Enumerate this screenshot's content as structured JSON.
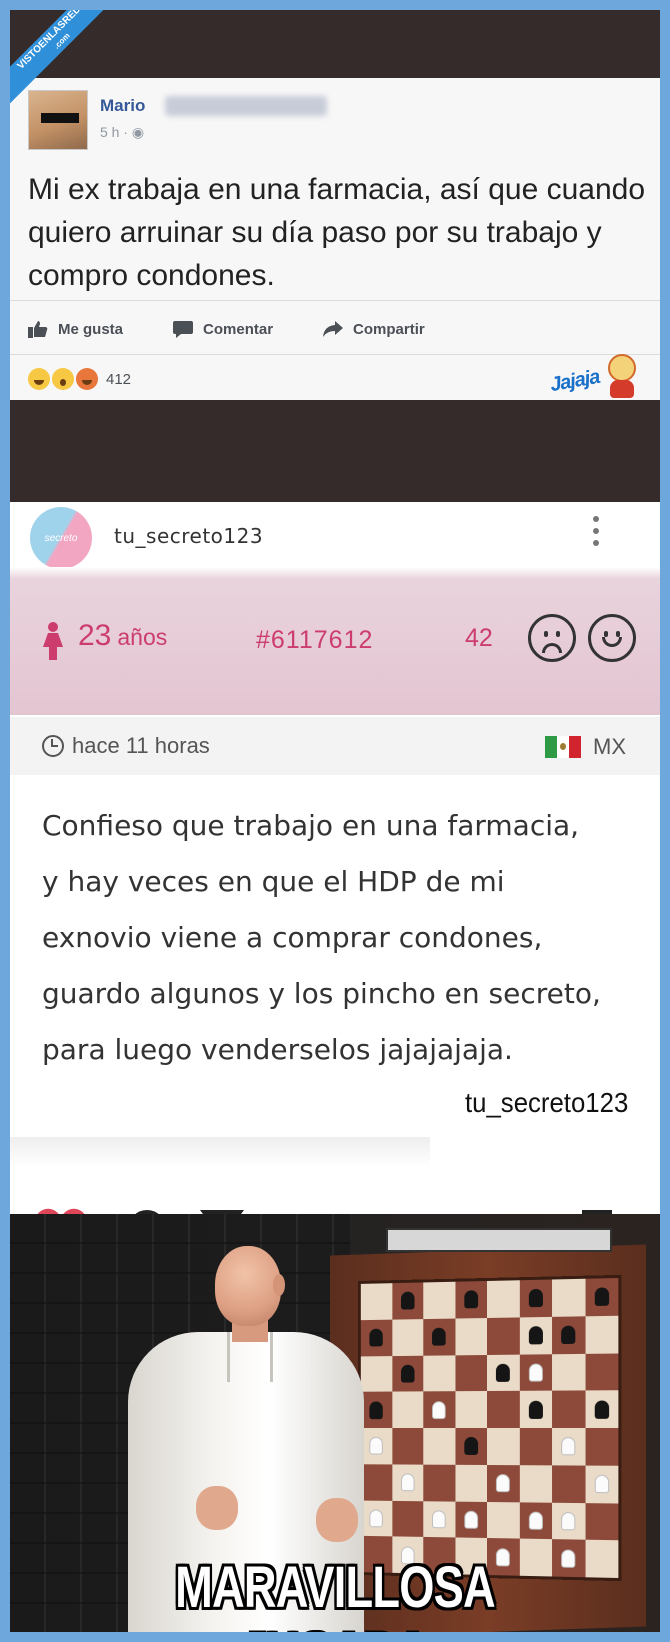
{
  "watermark": {
    "brand": "VISTOENLASREDES",
    "suffix": ".com"
  },
  "facebook": {
    "author": "Mario",
    "time": "5 h · ",
    "post_text": "Mi ex trabaja en una farmacia, así que cuando quiero arruinar su día paso por su trabajo y compro condones.",
    "actions": {
      "like": "Me gusta",
      "comment": "Comentar",
      "share": "Compartir"
    },
    "reactions": [
      "haha",
      "wow",
      "angry"
    ],
    "reaction_count": "412",
    "sticker_text": "Jajaja"
  },
  "confession": {
    "username": "tu_secreto123",
    "avatar_text": "secreto",
    "age": "23",
    "age_unit": "años",
    "post_id": "#6117612",
    "votes": "42",
    "posted": "hace 11 horas",
    "country": "MX",
    "text": "Confieso que trabajo en una farmacia, y hay veces en que el HDP de mi exnovio viene a comprar condones, guardo algunos y los pincho en secreto, para luego venderselos jajajajaja.",
    "watermark": "tu_secreto123"
  },
  "meme": {
    "caption": "MARAVILLOSA JUGADA",
    "board": [
      ".k.q.q.r",
      "p.p..pp.",
      ".p..pP..",
      "p.P..p.p",
      "P..p..P.",
      ".P..P..P",
      "P.PP.PP.",
      ".P..P.P."
    ]
  },
  "colors": {
    "accent_pink": "#cc3d6d",
    "fb_blue": "#365899",
    "frame_blue": "#6ea7dc"
  }
}
